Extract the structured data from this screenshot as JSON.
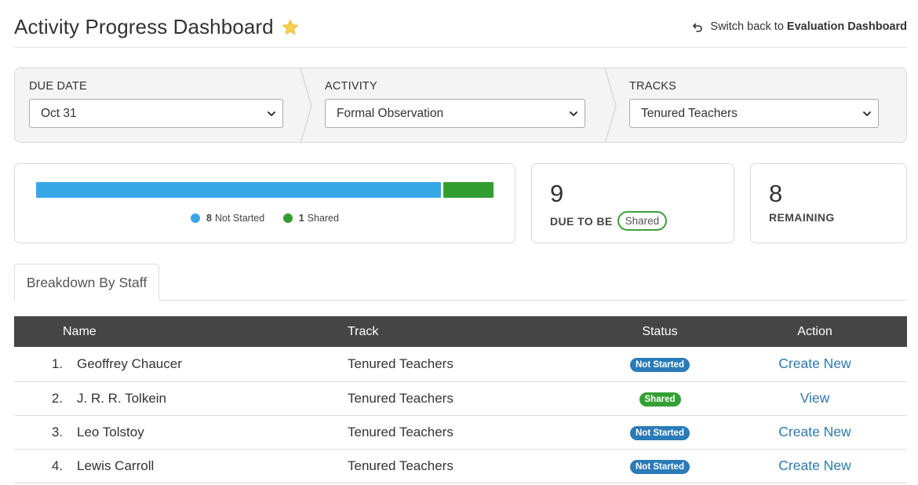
{
  "header": {
    "title": "Activity Progress Dashboard",
    "switch_prefix": "Switch back to",
    "switch_target": "Evaluation Dashboard"
  },
  "filters": {
    "due_date": {
      "label": "Due Date",
      "value": "Oct 31"
    },
    "activity": {
      "label": "Activity",
      "value": "Formal Observation"
    },
    "tracks": {
      "label": "Tracks",
      "value": "Tenured Teachers"
    }
  },
  "progress": {
    "segments": [
      {
        "count": "8",
        "label": "Not Started",
        "value": 8,
        "color": "#38a7e8"
      },
      {
        "count": "1",
        "label": "Shared",
        "value": 1,
        "color": "#329e32"
      }
    ]
  },
  "stats": {
    "due": {
      "number": "9",
      "label": "Due to be",
      "badge": "Shared"
    },
    "remaining": {
      "number": "8",
      "label": "Remaining"
    }
  },
  "tabs": [
    {
      "label": "Breakdown By Staff"
    }
  ],
  "table": {
    "columns": [
      "Name",
      "Track",
      "Status",
      "Action"
    ],
    "rows": [
      {
        "num": "1.",
        "name": "Geoffrey Chaucer",
        "track": "Tenured Teachers",
        "status": "Not Started",
        "status_color": "#2a7bb8",
        "action": "Create New"
      },
      {
        "num": "2.",
        "name": "J. R. R. Tolkein",
        "track": "Tenured Teachers",
        "status": "Shared",
        "status_color": "#34a034",
        "action": "View"
      },
      {
        "num": "3.",
        "name": "Leo Tolstoy",
        "track": "Tenured Teachers",
        "status": "Not Started",
        "status_color": "#2a7bb8",
        "action": "Create New"
      },
      {
        "num": "4.",
        "name": "Lewis Carroll",
        "track": "Tenured Teachers",
        "status": "Not Started",
        "status_color": "#2a7bb8",
        "action": "Create New"
      }
    ]
  },
  "colors": {
    "accent": "#2a7ab0",
    "header_bg": "#454545"
  },
  "icons": {
    "favorite": "star-icon",
    "switch": "undo-icon",
    "select": "chevron-down-icon"
  }
}
